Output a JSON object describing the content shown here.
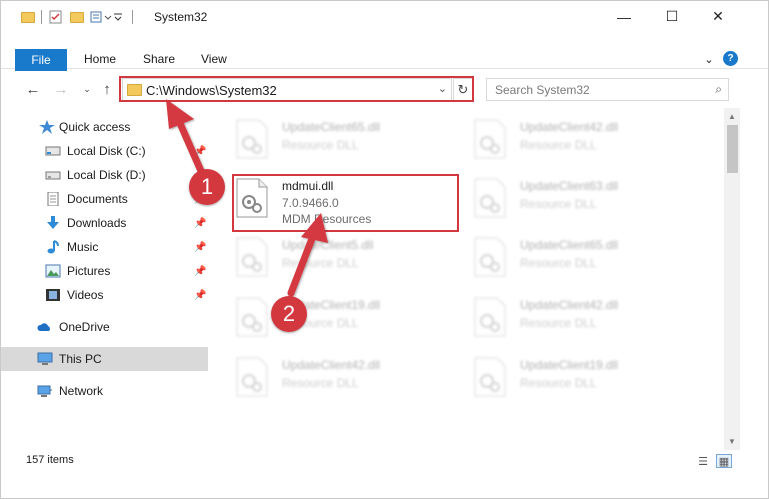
{
  "window": {
    "title": "System32",
    "minimize_glyph": "—",
    "maximize_glyph": "☐",
    "close_glyph": "✕"
  },
  "ribbon": {
    "tabs": [
      "File",
      "Home",
      "Share",
      "View"
    ]
  },
  "address": {
    "path": "C:\\Windows\\System32",
    "search_placeholder": "Search System32"
  },
  "sidebar": {
    "items": [
      {
        "label": "Quick access",
        "icon": "star-icon",
        "pinned": false
      },
      {
        "label": "Local Disk (C:)",
        "icon": "drive-icon",
        "pinned": true
      },
      {
        "label": "Local Disk (D:)",
        "icon": "drive-icon",
        "pinned": false
      },
      {
        "label": "Documents",
        "icon": "documents-icon",
        "pinned": true
      },
      {
        "label": "Downloads",
        "icon": "download-icon",
        "pinned": true
      },
      {
        "label": "Music",
        "icon": "music-icon",
        "pinned": true
      },
      {
        "label": "Pictures",
        "icon": "pictures-icon",
        "pinned": true
      },
      {
        "label": "Videos",
        "icon": "videos-icon",
        "pinned": true
      },
      {
        "label": "OneDrive",
        "icon": "cloud-icon",
        "pinned": false
      },
      {
        "label": "This PC",
        "icon": "computer-icon",
        "pinned": false
      },
      {
        "label": "Network",
        "icon": "network-icon",
        "pinned": false
      }
    ]
  },
  "files": {
    "left": [
      {
        "name": "UpdateClient65.dll",
        "type": "Resource DLL"
      },
      {
        "name": "UpdateClient5.dll",
        "type": "Resource DLL"
      },
      {
        "name": "UpdateClient19.dll",
        "type": "Resource DLL"
      },
      {
        "name": "UpdateClient42.dll",
        "type": "Resource DLL"
      }
    ],
    "right": [
      {
        "name": "UpdateClient42.dll",
        "type": "Resource DLL"
      },
      {
        "name": "UpdateClient63.dll",
        "type": "Resource DLL"
      },
      {
        "name": "UpdateClient65.dll",
        "type": "Resource DLL"
      },
      {
        "name": "UpdateClient42.dll",
        "type": "Resource DLL"
      },
      {
        "name": "UpdateClient19.dll",
        "type": "Resource DLL"
      }
    ],
    "focused": {
      "name": "mdmui.dll",
      "version": "7.0.9466.0",
      "description": "MDM Resources"
    }
  },
  "status": {
    "item_count": "157 items"
  },
  "annotations": {
    "badge1": "1",
    "badge2": "2",
    "color": "#d4383f"
  }
}
